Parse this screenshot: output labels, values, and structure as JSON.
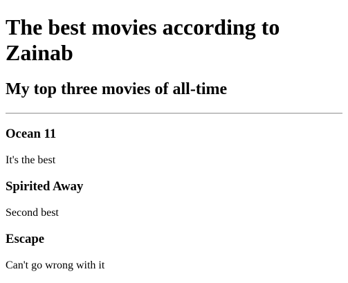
{
  "title": "The best movies according to Zainab",
  "subtitle": "My top three movies of all-time",
  "movies": [
    {
      "name": "Ocean 11",
      "comment": "It's the best"
    },
    {
      "name": "Spirited Away",
      "comment": "Second best"
    },
    {
      "name": "Escape",
      "comment": "Can't go wrong with it"
    }
  ]
}
